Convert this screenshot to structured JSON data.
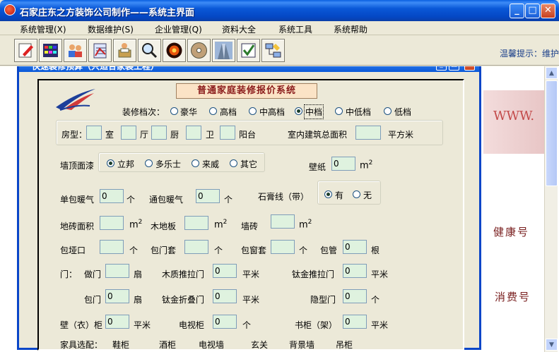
{
  "window": {
    "title": "石家庄东之方装饰公司制作——系统主界面"
  },
  "menu": [
    {
      "label": "系统管理(X)"
    },
    {
      "label": "数据维护(S)"
    },
    {
      "label": "企业管理(Q)"
    },
    {
      "label": "资料大全"
    },
    {
      "label": "系统工具"
    },
    {
      "label": "系统帮助"
    }
  ],
  "toolbar": {
    "icons": [
      "edit-icon",
      "calculator-icon",
      "users-icon",
      "checklist-icon",
      "print-icon",
      "magnifier-icon",
      "fire-icon",
      "disc-icon",
      "building-icon",
      "checkbox-icon",
      "network-icon"
    ],
    "tip": "温馨提示：维护"
  },
  "child": {
    "title": "快速装修预算（只适合家装工程）",
    "system_title": "普通家庭装修报价系统"
  },
  "grade": {
    "label": "装修档次：",
    "options": [
      "豪华",
      "高档",
      "中高档",
      "中档",
      "中低档",
      "低档"
    ],
    "selected": "中档"
  },
  "room": {
    "label": "房型：",
    "shi": "室",
    "ting": "厅",
    "chu": "厨",
    "wei": "卫",
    "yangtai": "阳台",
    "area_label": "室内建筑总面积",
    "area_unit": "平方米"
  },
  "paint": {
    "label": "墙顶面漆",
    "options": [
      "立邦",
      "多乐士",
      "来威",
      "其它"
    ],
    "selected": "立邦"
  },
  "wallpaper": {
    "label": "壁纸",
    "value": "0",
    "unit": "m",
    "sup": "2"
  },
  "heater_single": {
    "label": "单包暖气",
    "value": "0",
    "unit": "个"
  },
  "heater_through": {
    "label": "通包暖气",
    "value": "0",
    "unit": "个"
  },
  "gypsum": {
    "label": "石膏线（带）",
    "options": [
      "有",
      "无"
    ],
    "selected": "有"
  },
  "floor_tile": {
    "label": "地砖面积",
    "unit": "m",
    "sup": "2"
  },
  "wood_floor": {
    "label": "木地板",
    "unit": "m",
    "sup": "2"
  },
  "wall_tile": {
    "label": "墙砖",
    "unit": "m",
    "sup": "2"
  },
  "yakou": {
    "label": "包垭口",
    "unit": "个"
  },
  "door_cover": {
    "label": "包门套",
    "unit": "个"
  },
  "window_cover": {
    "label": "包窗套",
    "unit": "个"
  },
  "pipe": {
    "label": "包管",
    "value": "0",
    "unit": "根"
  },
  "door_row1": {
    "label": "门：",
    "make_door": {
      "label": "做门",
      "unit": "扇"
    },
    "wood_slide": {
      "label": "木质推拉门",
      "value": "0",
      "unit": "平米"
    },
    "tial_slide": {
      "label": "钛金推拉门",
      "value": "0",
      "unit": "平米"
    }
  },
  "door_row2": {
    "wrap_door": {
      "label": "包门",
      "value": "0",
      "unit": "扇"
    },
    "tial_fold": {
      "label": "钛金折叠门",
      "value": "0",
      "unit": "平米"
    },
    "hidden_door": {
      "label": "隐型门",
      "value": "0",
      "unit": "个"
    }
  },
  "cabinet_row": {
    "wardrobe": {
      "label": "壁（衣）柜",
      "value": "0",
      "unit": "平米"
    },
    "tv": {
      "label": "电视柜",
      "value": "0",
      "unit": "个"
    },
    "bookcase": {
      "label": "书柜（架）",
      "value": "0",
      "unit": "平米"
    }
  },
  "bottom_row": {
    "label": "家具选配：",
    "items": [
      "鞋柜",
      "酒柜",
      "电视墙",
      "玄关",
      "背景墙",
      "吊柜"
    ]
  },
  "right_deco": {
    "www": "WWW.",
    "h1": "健康号",
    "h2": "消费号"
  }
}
